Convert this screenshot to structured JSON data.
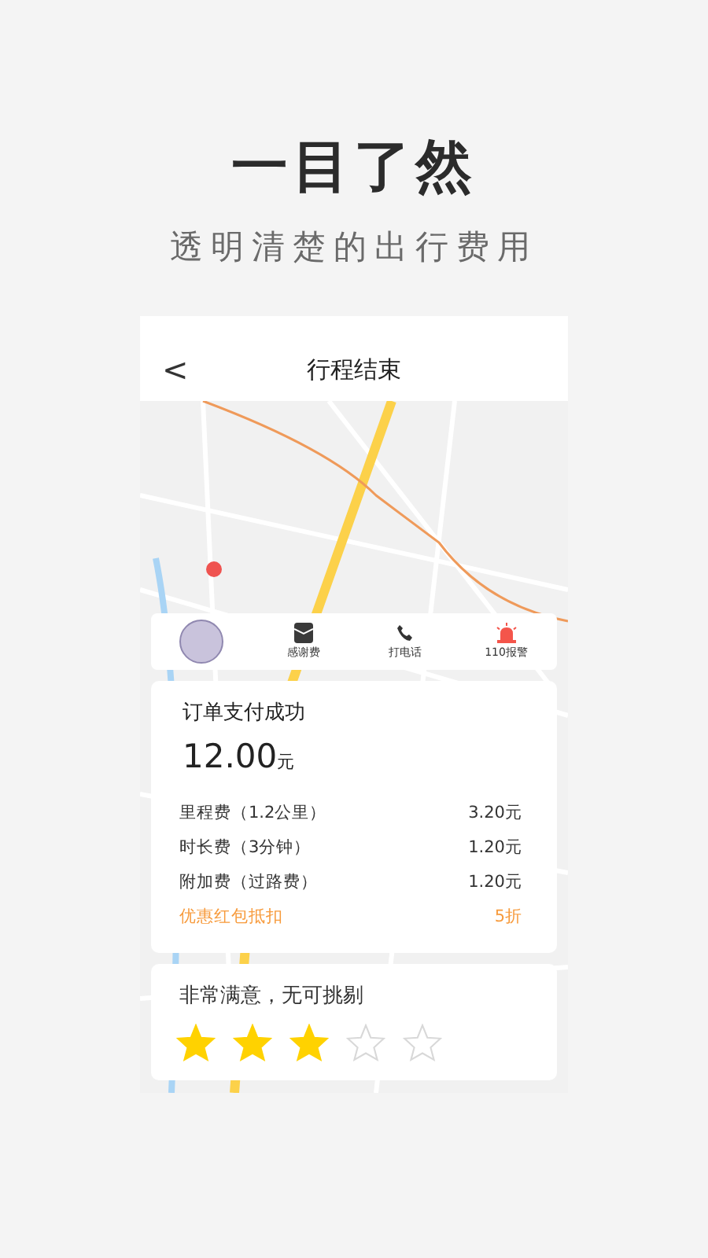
{
  "headline": "一目了然",
  "subtitle": "透明清楚的出行费用",
  "header": {
    "back": "<",
    "title": "行程结束"
  },
  "actions": [
    {
      "kind": "avatar"
    },
    {
      "kind": "envelope",
      "label": "感谢费"
    },
    {
      "kind": "phone",
      "label": "打电话"
    },
    {
      "kind": "alarm",
      "label": "110报警"
    }
  ],
  "order": {
    "title": "订单支付成功",
    "amount": "12.00",
    "unit": "元",
    "items": [
      {
        "kind": "fee",
        "label": "里程费（1.2公里）",
        "value": "3.20元"
      },
      {
        "kind": "fee",
        "label": "时长费（3分钟）",
        "value": "1.20元"
      },
      {
        "kind": "fee",
        "label": "附加费（过路费）",
        "value": "1.20元"
      },
      {
        "kind": "discount",
        "label": "优惠红包抵扣",
        "value": "5折"
      }
    ]
  },
  "rating": {
    "text": "非常满意，无可挑剔",
    "stars": 3
  }
}
